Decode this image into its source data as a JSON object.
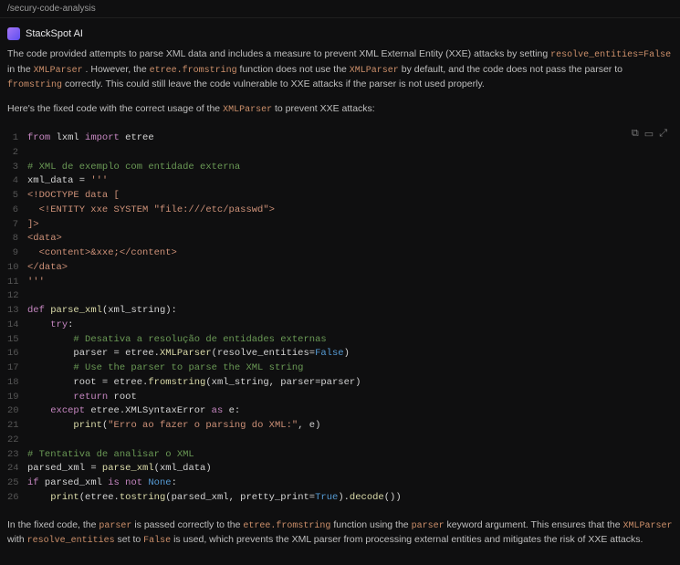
{
  "titlebar": {
    "path": "/secury-code-analysis"
  },
  "header": {
    "brand": "StackSpot AI"
  },
  "explain": {
    "p1_a": "The code provided attempts to parse XML data and includes a measure to prevent XML External Entity (XXE) attacks by setting ",
    "p1_code1": "resolve_entities=False",
    "p1_b": " in the ",
    "p1_code2": "XMLParser",
    "p1_c": ". However, the ",
    "p1_code3": "etree.fromstring",
    "p1_d": " function does not use the ",
    "p1_code4": "XMLParser",
    "p1_e": " by default, and the code does not pass the parser to ",
    "p1_code5": "fromstring",
    "p1_f": " correctly. This could still leave the code vulnerable to XXE attacks if the parser is not used properly.",
    "p2_a": "Here's the fixed code with the correct usage of the ",
    "p2_code1": "XMLParser",
    "p2_b": " to prevent XXE attacks:"
  },
  "toolbar": {
    "copy_tip": "⧉",
    "wrap_tip": "▭",
    "expand_tip": "⤢"
  },
  "code": {
    "lines": [
      [
        [
          "kw",
          "from"
        ],
        [
          "pl",
          " lxml "
        ],
        [
          "kw",
          "import"
        ],
        [
          "pl",
          " etree"
        ]
      ],
      [
        [
          "pl",
          ""
        ]
      ],
      [
        [
          "cmt",
          "# XML de exemplo com entidade externa"
        ]
      ],
      [
        [
          "pl",
          "xml_data "
        ],
        [
          "pl",
          "= "
        ],
        [
          "str",
          "'''"
        ]
      ],
      [
        [
          "str",
          "<!DOCTYPE data ["
        ]
      ],
      [
        [
          "str",
          "  <!ENTITY xxe SYSTEM \"file:///etc/passwd\">"
        ]
      ],
      [
        [
          "str",
          "]>"
        ]
      ],
      [
        [
          "str",
          "<data>"
        ]
      ],
      [
        [
          "str",
          "  <content>&xxe;</content>"
        ]
      ],
      [
        [
          "str",
          "</data>"
        ]
      ],
      [
        [
          "str",
          "'''"
        ]
      ],
      [
        [
          "pl",
          ""
        ]
      ],
      [
        [
          "kw",
          "def"
        ],
        [
          "pl",
          " "
        ],
        [
          "fn",
          "parse_xml"
        ],
        [
          "pl",
          "(xml_string):"
        ]
      ],
      [
        [
          "pl",
          "    "
        ],
        [
          "kw",
          "try"
        ],
        [
          "pl",
          ":"
        ]
      ],
      [
        [
          "pl",
          "        "
        ],
        [
          "cmt",
          "# Desativa a resolução de entidades externas"
        ]
      ],
      [
        [
          "pl",
          "        parser "
        ],
        [
          "pl",
          "= etree."
        ],
        [
          "fn",
          "XMLParser"
        ],
        [
          "pl",
          "(resolve_entities="
        ],
        [
          "bool",
          "False"
        ],
        [
          "pl",
          ")"
        ]
      ],
      [
        [
          "pl",
          "        "
        ],
        [
          "cmt",
          "# Use the parser to parse the XML string"
        ]
      ],
      [
        [
          "pl",
          "        root "
        ],
        [
          "pl",
          "= etree."
        ],
        [
          "fn",
          "fromstring"
        ],
        [
          "pl",
          "(xml_string, parser=parser)"
        ]
      ],
      [
        [
          "pl",
          "        "
        ],
        [
          "kw",
          "return"
        ],
        [
          "pl",
          " root"
        ]
      ],
      [
        [
          "pl",
          "    "
        ],
        [
          "kw",
          "except"
        ],
        [
          "pl",
          " etree.XMLSyntaxError "
        ],
        [
          "kw",
          "as"
        ],
        [
          "pl",
          " e:"
        ]
      ],
      [
        [
          "pl",
          "        "
        ],
        [
          "fn",
          "print"
        ],
        [
          "pl",
          "("
        ],
        [
          "str",
          "\"Erro ao fazer o parsing do XML:\""
        ],
        [
          "pl",
          ", e)"
        ]
      ],
      [
        [
          "pl",
          ""
        ]
      ],
      [
        [
          "cmt",
          "# Tentativa de analisar o XML"
        ]
      ],
      [
        [
          "pl",
          "parsed_xml "
        ],
        [
          "pl",
          "= "
        ],
        [
          "fn",
          "parse_xml"
        ],
        [
          "pl",
          "(xml_data)"
        ]
      ],
      [
        [
          "kw",
          "if"
        ],
        [
          "pl",
          " parsed_xml "
        ],
        [
          "kw",
          "is not"
        ],
        [
          "pl",
          " "
        ],
        [
          "bool",
          "None"
        ],
        [
          "pl",
          ":"
        ]
      ],
      [
        [
          "pl",
          "    "
        ],
        [
          "fn",
          "print"
        ],
        [
          "pl",
          "(etree."
        ],
        [
          "fn",
          "tostring"
        ],
        [
          "pl",
          "(parsed_xml, pretty_print="
        ],
        [
          "bool",
          "True"
        ],
        [
          "pl",
          ")."
        ],
        [
          "fn",
          "decode"
        ],
        [
          "pl",
          "())"
        ]
      ]
    ]
  },
  "footer": {
    "a": "In the fixed code, the ",
    "c1": "parser",
    "b": " is passed correctly to the ",
    "c2": "etree.fromstring",
    "c": " function using the ",
    "c3": "parser",
    "d": " keyword argument. This ensures that the ",
    "c4": "XMLParser",
    "e": " with ",
    "c5": "resolve_entities",
    "f": " set to ",
    "c6": "False",
    "g": " is used, which prevents the XML parser from processing external entities and mitigates the risk of XXE attacks."
  }
}
